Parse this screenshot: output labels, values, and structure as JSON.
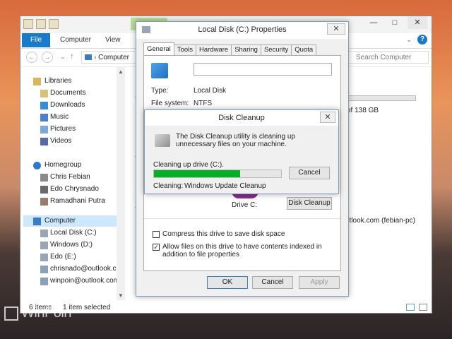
{
  "explorer": {
    "ribbon_tabs": [
      "File",
      "Computer",
      "View"
    ],
    "address_text": "Computer",
    "search_placeholder": "Search Computer",
    "nav": {
      "libraries": "Libraries",
      "library_items": [
        "Documents",
        "Downloads",
        "Music",
        "Pictures",
        "Videos"
      ],
      "homegroup": "Homegroup",
      "homegroup_items": [
        "Chris Febian",
        "Edo Chrysnado",
        "Ramadhani Putra"
      ],
      "computer": "Computer",
      "computer_items": [
        "Local Disk (C:)",
        "Windows (D:)",
        "Edo (E:)",
        "chrisnado@outlook.co",
        "winpoin@outlook.com"
      ]
    },
    "right_snippets": {
      "free_of": "of 138 GB",
      "account": "utlook.com (febian-pc)"
    },
    "status": {
      "items": "6 items",
      "selected": "1 item selected"
    }
  },
  "properties": {
    "title": "Local Disk (C:) Properties",
    "tabs": [
      "General",
      "Tools",
      "Hardware",
      "Sharing",
      "Security",
      "Quota"
    ],
    "name_value": "",
    "type_label": "Type:",
    "type_value": "Local Disk",
    "fs_label": "File system:",
    "fs_value": "NTFS",
    "drive_label": "Drive C:",
    "disk_cleanup_button": "Disk Cleanup",
    "compress_label": "Compress this drive to save disk space",
    "index_label": "Allow files on this drive to have contents indexed in addition to file properties",
    "compress_checked": false,
    "index_checked": true,
    "ok_label": "OK",
    "cancel_label": "Cancel",
    "apply_label": "Apply"
  },
  "cleanup": {
    "title": "Disk Cleanup",
    "message": "The Disk Cleanup utility is cleaning up unnecessary files on your machine.",
    "cleaning_drive": "Cleaning up drive  (C:).",
    "cancel_label": "Cancel",
    "cleaning_label": "Cleaning:",
    "cleaning_item": "Windows Update Cleanup",
    "progress_fraction": 0.68
  },
  "watermark": "WinPoin",
  "colors": {
    "accent": "#1979ca",
    "progress": "#06b025",
    "selection": "#cce8ff"
  }
}
